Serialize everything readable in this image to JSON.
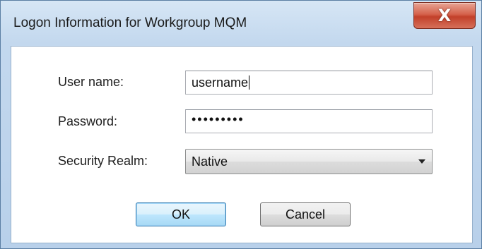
{
  "window": {
    "title": "Logon Information for Workgroup MQM",
    "close_glyph": "X",
    "close_icon": "close-icon"
  },
  "form": {
    "username_label": "User name:",
    "username_value": "username",
    "password_label": "Password:",
    "password_mask": "•••••••••",
    "realm_label": "Security Realm:",
    "realm_value": "Native",
    "realm_icon": "chevron-down-icon"
  },
  "buttons": {
    "ok": "OK",
    "cancel": "Cancel"
  },
  "colors": {
    "frame": "#c3d8ee",
    "close_button": "#c2402a",
    "default_button": "#bee6fd"
  }
}
